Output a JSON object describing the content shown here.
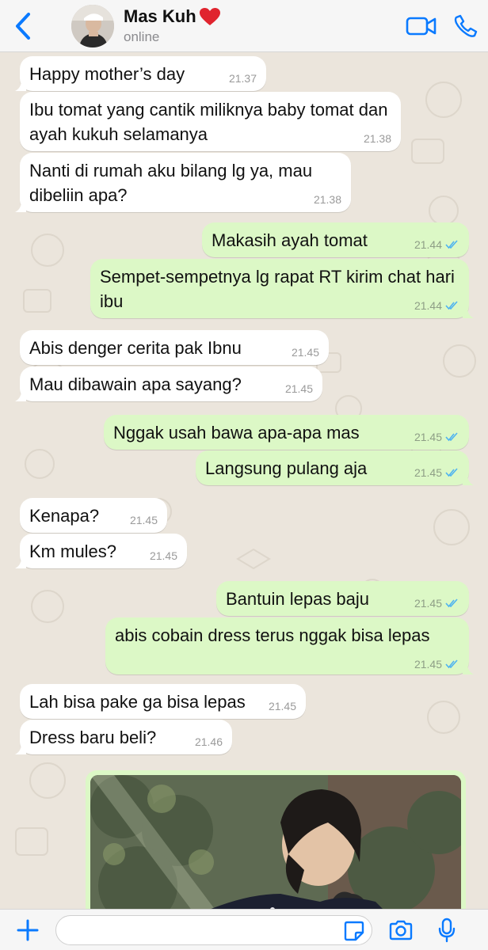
{
  "header": {
    "contact_name": "Mas Kuh",
    "contact_status": "online",
    "heart": "❤️",
    "accent_color": "#0a7aff"
  },
  "messages": [
    {
      "dir": "in",
      "text": "Happy mother’s day",
      "time": "21.37"
    },
    {
      "dir": "in",
      "text": "Ibu tomat yang cantik miliknya baby tomat dan ayah kukuh selamanya",
      "time": "21.38"
    },
    {
      "dir": "in",
      "text": "Nanti di rumah aku bilang lg ya, mau dibeliin apa?",
      "time": "21.38"
    },
    {
      "dir": "out",
      "text": "Makasih ayah tomat",
      "time": "21.44",
      "status": "read"
    },
    {
      "dir": "out",
      "text": "Sempet-sempetnya lg rapat RT kirim chat hari ibu",
      "time": "21.44",
      "status": "read"
    },
    {
      "dir": "in",
      "text": "Abis denger cerita pak Ibnu",
      "time": "21.45"
    },
    {
      "dir": "in",
      "text": "Mau dibawain apa sayang?",
      "time": "21.45"
    },
    {
      "dir": "out",
      "text": "Nggak usah bawa apa-apa mas",
      "time": "21.45",
      "status": "read"
    },
    {
      "dir": "out",
      "text": "Langsung pulang aja",
      "time": "21.45",
      "status": "read"
    },
    {
      "dir": "in",
      "text": "Kenapa?",
      "time": "21.45"
    },
    {
      "dir": "in",
      "text": "Km mules?",
      "time": "21.45"
    },
    {
      "dir": "out",
      "text": "Bantuin lepas baju",
      "time": "21.45",
      "status": "read"
    },
    {
      "dir": "out",
      "text": "abis cobain dress terus nggak bisa lepas",
      "time": "21.45",
      "status": "read"
    },
    {
      "dir": "in",
      "text": "Lah bisa pake ga bisa lepas",
      "time": "21.45"
    },
    {
      "dir": "in",
      "text": "Dress baru beli?",
      "time": "21.46"
    }
  ],
  "photo_message": {
    "dir": "out",
    "media": "photo"
  },
  "input_bar": {
    "placeholder": ""
  },
  "colors": {
    "incoming_bubble": "#ffffff",
    "outgoing_bubble": "#dcf8c6",
    "read_tick": "#4fb3f0",
    "wallpaper": "#ebe5dc"
  },
  "icons": {
    "back": "chevron-left-icon",
    "video_call": "video-camera-icon",
    "voice_call": "phone-icon",
    "attach": "plus-icon",
    "sticker": "sticker-icon",
    "camera": "camera-icon",
    "mic": "microphone-icon"
  }
}
